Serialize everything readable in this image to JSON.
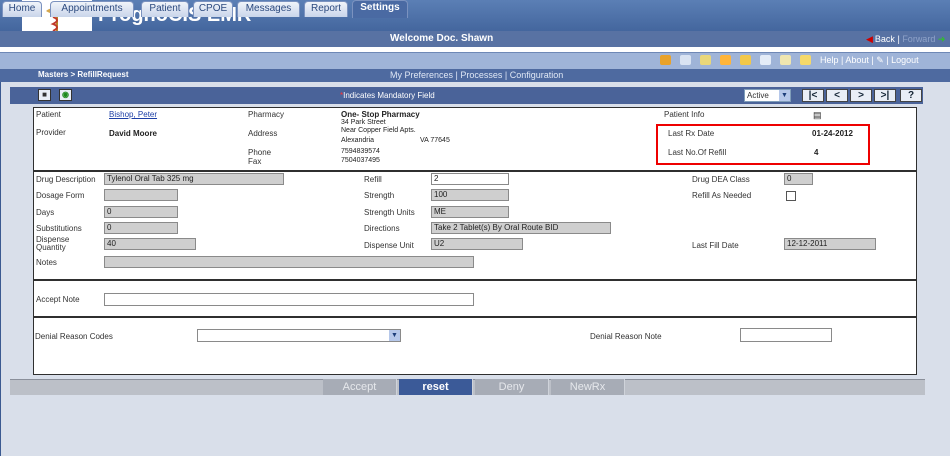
{
  "header": {
    "app_title": "PrognoCIS EMR",
    "welcome": "Welcome Doc. Shawn",
    "back": "Back",
    "sep": "|",
    "forward": "Forward"
  },
  "tabs": [
    "Home",
    "Appointments",
    "Patient",
    "CPOE",
    "Messages",
    "Report",
    "Settings"
  ],
  "active_tab": "Settings",
  "top_links": {
    "help": "Help",
    "about": "About",
    "logout": "Logout"
  },
  "breadcrumb": "Masters > RefillRequest",
  "sub_links": {
    "prefs": "My Preferences",
    "processes": "Processes",
    "config": "Configuration"
  },
  "toolbar": {
    "mandatory_star": "*",
    "mandatory_text": "Indicates Mandatory Field",
    "status_value": "Active",
    "nav_first": "|<",
    "nav_prev": "<",
    "nav_next": ">",
    "nav_last": ">|",
    "help": "?"
  },
  "info": {
    "patient_label": "Patient",
    "patient_value": "Bishop, Peter",
    "provider_label": "Provider",
    "provider_value": "David Moore",
    "pharmacy_label": "Pharmacy",
    "pharmacy_name": "One- Stop Pharmacy",
    "address_label": "Address",
    "address_line1": "34 Park Street",
    "address_line2": "Near Copper Field Apts.",
    "address_line3": "Alexandria",
    "address_state": "VA 77645",
    "phone_label": "Phone",
    "phone_value": "7594839574",
    "fax_label": "Fax",
    "fax_value": "7504037495",
    "patient_info_label": "Patient Info",
    "last_rx_label": "Last Rx Date",
    "last_rx_value": "01-24-2012",
    "last_refill_label": "Last No.Of Refill",
    "last_refill_value": "4"
  },
  "drug": {
    "drug_desc_label": "Drug Description",
    "drug_desc_value": "Tylenol Oral Tab 325 mg",
    "dosage_label": "Dosage Form",
    "dosage_value": "",
    "days_label": "Days",
    "days_value": "0",
    "subs_label": "Substitutions",
    "subs_value": "0",
    "dispense_qty_label1": "Dispense",
    "dispense_qty_label2": "Quantity",
    "dispense_qty_value": "40",
    "notes_label": "Notes",
    "notes_value": "",
    "refill_label": "Refill",
    "refill_value": "2",
    "strength_label": "Strength",
    "strength_value": "100",
    "strength_units_label": "Strength Units",
    "strength_units_value": "ME",
    "directions_label": "Directions",
    "directions_value": "Take 2 Tablet(s) By Oral Route  BID",
    "dispense_unit_label": "Dispense Unit",
    "dispense_unit_value": "U2",
    "dea_label": "Drug DEA Class",
    "dea_value": "0",
    "refill_needed_label": "Refill As Needed",
    "last_fill_label": "Last Fill Date",
    "last_fill_value": "12-12-2011"
  },
  "accept": {
    "label": "Accept Note",
    "value": ""
  },
  "denial": {
    "codes_label": "Denial Reason Codes",
    "codes_value": "",
    "note_label": "Denial Reason Note",
    "note_value": ""
  },
  "actions": {
    "accept": "Accept",
    "reset": "reset",
    "deny": "Deny",
    "newrx": "NewRx"
  }
}
